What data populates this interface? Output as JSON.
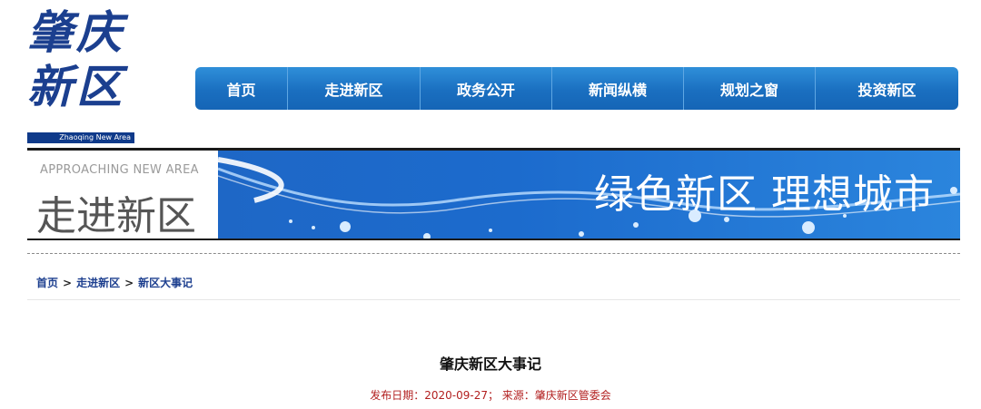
{
  "logo": {
    "line1": "肇庆",
    "line2": "新区",
    "subtitle": "Zhaoqing New Area"
  },
  "nav": {
    "items": [
      {
        "label": "首页"
      },
      {
        "label": "走进新区"
      },
      {
        "label": "政务公开"
      },
      {
        "label": "新闻纵横"
      },
      {
        "label": "规划之窗"
      },
      {
        "label": "投资新区"
      }
    ]
  },
  "banner": {
    "english": "APPROACHING NEW AREA",
    "title": "走进新区",
    "slogan": "绿色新区 理想城市"
  },
  "breadcrumb": {
    "items": [
      {
        "label": "首页"
      },
      {
        "label": "走进新区"
      },
      {
        "label": "新区大事记"
      }
    ],
    "separator": ">"
  },
  "article": {
    "title": "肇庆新区大事记",
    "meta": "发布日期：2020-09-27； 来源：肇庆新区管委会"
  },
  "colors": {
    "nav": "#1a6fc0",
    "banner": "#1e67c6",
    "meta": "#b21f1f",
    "crumb": "#1d3f8f"
  }
}
